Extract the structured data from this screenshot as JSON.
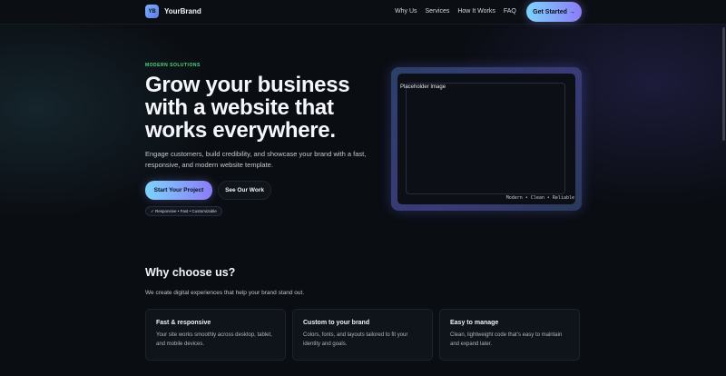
{
  "header": {
    "logo_text": "YB",
    "brand_name": "YourBrand",
    "nav": [
      "Why Us",
      "Services",
      "How It Works",
      "FAQ"
    ],
    "cta": "Get Started →"
  },
  "hero": {
    "eyebrow": "MODERN SOLUTIONS",
    "title": "Grow your business with a website that works everywhere.",
    "subtitle": "Engage customers, build credibility, and showcase your brand with a fast, responsive, and modern website template.",
    "primary_button": "Start Your Project",
    "secondary_button": "See Our Work",
    "pill": "✓ Responsive • Fast • Customizable",
    "mockup": {
      "label": "Placeholder Image",
      "caption": "Modern • Clean • Reliable"
    }
  },
  "why": {
    "title": "Why choose us?",
    "subtitle": "We create digital experiences that help your brand stand out.",
    "cards": [
      {
        "title": "Fast & responsive",
        "text": "Your site works smoothly across desktop, tablet, and mobile devices."
      },
      {
        "title": "Custom to your brand",
        "text": "Colors, fonts, and layouts tailored to fit your identity and goals."
      },
      {
        "title": "Easy to manage",
        "text": "Clean, lightweight code that’s easy to maintain and expand later."
      }
    ]
  },
  "colors": {
    "accent_start": "#7dd3fc",
    "accent_end": "#8b7cf6",
    "eyebrow": "#4ade80",
    "background": "#0a0d12"
  }
}
